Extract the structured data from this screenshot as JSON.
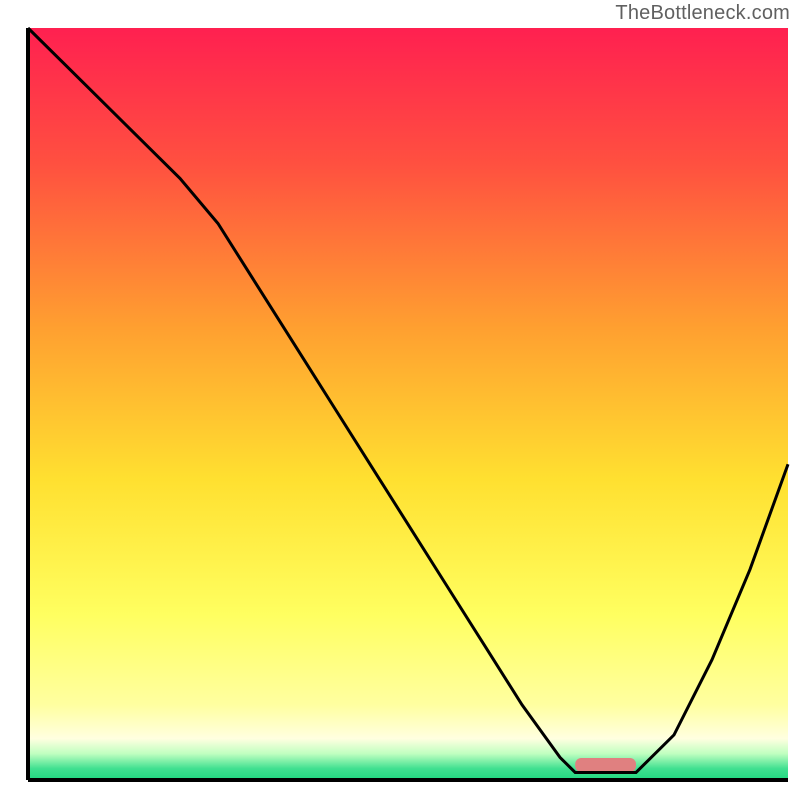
{
  "watermark": "TheBottleneck.com",
  "chart_data": {
    "type": "line",
    "title": "",
    "xlabel": "",
    "ylabel": "",
    "xlim": [
      0,
      100
    ],
    "ylim": [
      0,
      100
    ],
    "series": [
      {
        "name": "curve",
        "x": [
          0,
          5,
          10,
          15,
          20,
          25,
          30,
          35,
          40,
          45,
          50,
          55,
          60,
          65,
          70,
          72,
          76,
          80,
          85,
          90,
          95,
          100
        ],
        "values": [
          100,
          95,
          90,
          85,
          80,
          74,
          66,
          58,
          50,
          42,
          34,
          26,
          18,
          10,
          3,
          1,
          1,
          1,
          6,
          16,
          28,
          42
        ]
      }
    ],
    "marker": {
      "x_start": 72,
      "x_end": 80,
      "y": 2,
      "color": "#e08080"
    },
    "gradient_stops": [
      {
        "offset": 0,
        "color": "#ff2050"
      },
      {
        "offset": 0.18,
        "color": "#ff5040"
      },
      {
        "offset": 0.4,
        "color": "#ffa030"
      },
      {
        "offset": 0.6,
        "color": "#ffe030"
      },
      {
        "offset": 0.78,
        "color": "#ffff60"
      },
      {
        "offset": 0.9,
        "color": "#ffffa0"
      },
      {
        "offset": 0.945,
        "color": "#ffffe0"
      },
      {
        "offset": 0.965,
        "color": "#c0ffc0"
      },
      {
        "offset": 0.985,
        "color": "#40e090"
      },
      {
        "offset": 1.0,
        "color": "#20d880"
      }
    ],
    "axes": {
      "stroke": "#000000",
      "stroke_width": 4
    }
  }
}
